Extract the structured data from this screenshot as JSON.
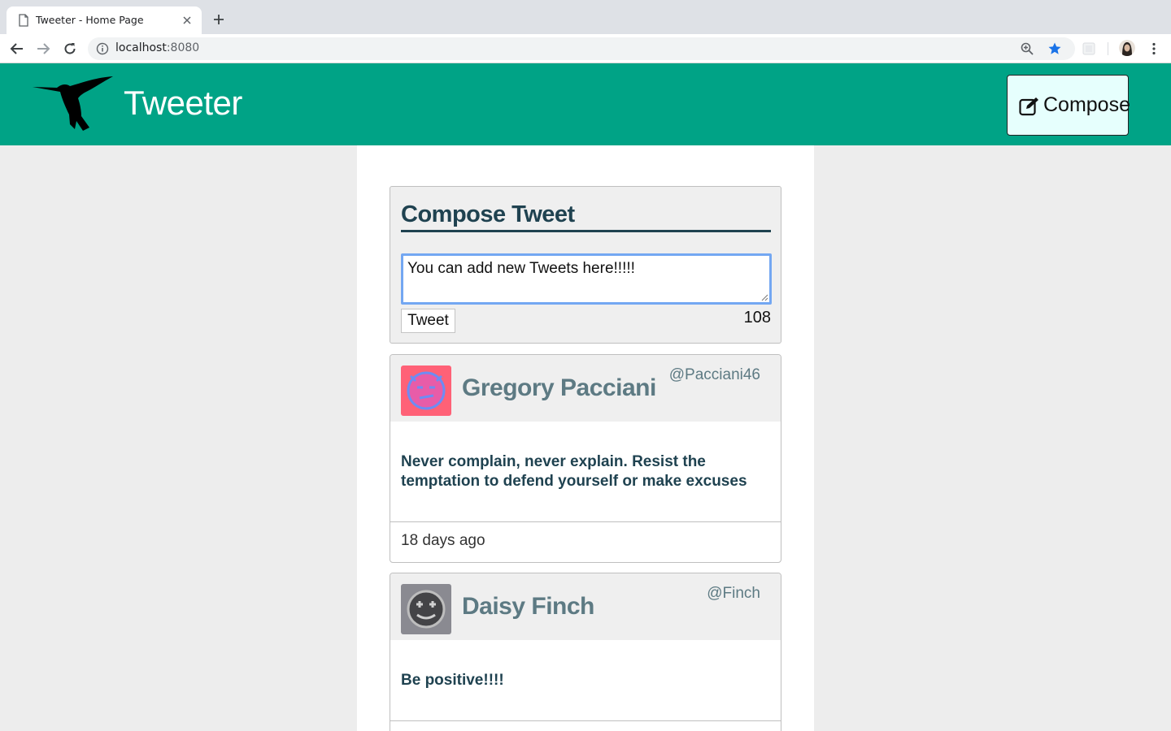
{
  "browser": {
    "tab_title": "Tweeter - Home Page",
    "url_host": "localhost",
    "url_port": ":8080"
  },
  "header": {
    "title": "Tweeter",
    "compose_label": "Compose"
  },
  "compose": {
    "heading": "Compose Tweet",
    "text": "You can add new Tweets here!!!!!",
    "button_label": "Tweet",
    "counter": "108"
  },
  "tweets": [
    {
      "name": "Gregory Pacciani",
      "handle": "@Pacciani46",
      "content": "Never complain, never explain. Resist the temptation to defend yourself or make excuses",
      "time": "18 days ago"
    },
    {
      "name": "Daisy Finch",
      "handle": "@Finch",
      "content": "Be positive!!!!"
    }
  ],
  "colors": {
    "header_bg": "#00a386",
    "compose_btn_bg": "#e6fffd",
    "heading_text": "#1f4250",
    "name_text": "#5d7a83",
    "textarea_focus": "#73a7f2"
  }
}
